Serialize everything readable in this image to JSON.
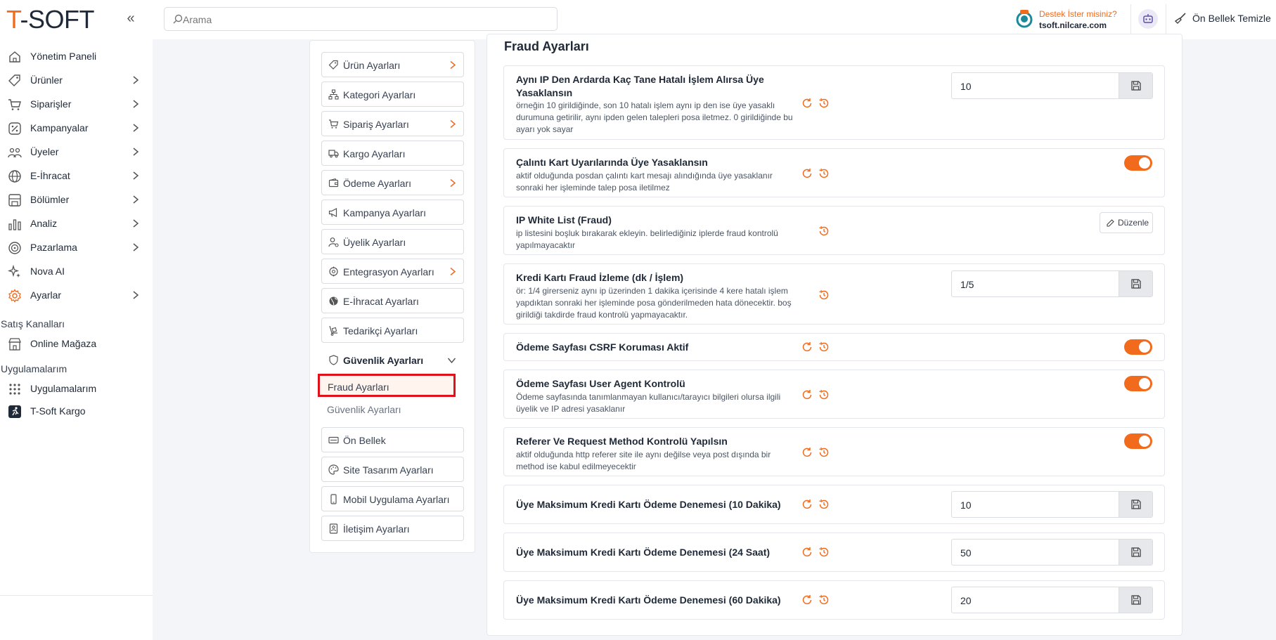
{
  "header": {
    "logo": "T-SOFT",
    "search_placeholder": "Arama",
    "support_question": "Destek İster misiniz?",
    "support_domain": "tsoft.nilcare.com",
    "cache_label": "Ön Bellek Temizle"
  },
  "sidebar": {
    "items": [
      {
        "label": "Yönetim Paneli",
        "icon": "home-icon"
      },
      {
        "label": "Ürünler",
        "icon": "tag-icon"
      },
      {
        "label": "Siparişler",
        "icon": "cart-icon"
      },
      {
        "label": "Kampanyalar",
        "icon": "percent-icon"
      },
      {
        "label": "Üyeler",
        "icon": "users-icon"
      },
      {
        "label": "E-İhracat",
        "icon": "globe-icon"
      },
      {
        "label": "Bölümler",
        "icon": "layout-icon"
      },
      {
        "label": "Analiz",
        "icon": "chart-icon"
      },
      {
        "label": "Pazarlama",
        "icon": "target-icon"
      },
      {
        "label": "Nova AI",
        "icon": "sparkle-icon"
      },
      {
        "label": "Ayarlar",
        "icon": "gear-icon"
      }
    ],
    "sales_channels_title": "Satış Kanalları",
    "online_store": "Online Mağaza",
    "apps_title": "Uygulamalarım",
    "apps_item": "Uygulamalarım",
    "kargo_item": "T-Soft Kargo"
  },
  "settings_menu": {
    "items": [
      {
        "label": "Ürün Ayarları",
        "icon": "tag-icon"
      },
      {
        "label": "Kategori Ayarları",
        "icon": "hierarchy-icon"
      },
      {
        "label": "Sipariş Ayarları",
        "icon": "cart-icon"
      },
      {
        "label": "Kargo Ayarları",
        "icon": "truck-icon"
      },
      {
        "label": "Ödeme Ayarları",
        "icon": "wallet-icon"
      },
      {
        "label": "Kampanya Ayarları",
        "icon": "megaphone-icon"
      },
      {
        "label": "Üyelik Ayarları",
        "icon": "user-gear-icon"
      },
      {
        "label": "Entegrasyon Ayarları",
        "icon": "integration-icon"
      },
      {
        "label": "E-İhracat Ayarları",
        "icon": "globe-icon"
      },
      {
        "label": "Tedarikçi Ayarları",
        "icon": "dolly-icon"
      },
      {
        "label": "Güvenlik Ayarları",
        "icon": "shield-icon"
      },
      {
        "label": "Ön Bellek",
        "icon": "memory-icon"
      },
      {
        "label": "Site Tasarım Ayarları",
        "icon": "palette-icon"
      },
      {
        "label": "Mobil Uygulama Ayarları",
        "icon": "mobile-icon"
      },
      {
        "label": "İletişim Ayarları",
        "icon": "contact-icon"
      }
    ],
    "sub_active": "Fraud Ayarları",
    "sub_other": "Güvenlik Ayarları"
  },
  "main": {
    "title": "Fraud Ayarları",
    "rows": [
      {
        "title": "Aynı IP Den Ardarda Kaç Tane Hatalı İşlem Alırsa Üye Yasaklansın",
        "desc": "örneğin 10 girildiğinde, son 10 hatalı işlem aynı ip den ise üye yasaklı durumuna getirilir, aynı ipden gelen talepleri posa iletmez. 0 girildiğinde bu ayarı yok sayar",
        "control": "input",
        "value": "10"
      },
      {
        "title": "Çalıntı Kart Uyarılarında Üye Yasaklansın",
        "desc": "aktif olduğunda posdan çalıntı kart mesajı alındığında üye yasaklanır sonraki her işleminde talep posa iletilmez",
        "control": "toggle"
      },
      {
        "title": "IP White List (Fraud)",
        "desc": "ip listesini boşluk bırakarak ekleyin. belirlediğiniz iplerde fraud kontrolü yapılmayacaktır",
        "control": "edit",
        "edit_label": "Düzenle"
      },
      {
        "title": "Kredi Kartı Fraud İzleme (dk / İşlem)",
        "desc": "ör: 1/4 girerseniz aynı ip üzerinden 1 dakika içerisinde 4 kere hatalı işlem yapdıktan sonraki her işleminde posa gönderilmeden hata dönecektir. boş girildiği takdirde fraud kontrolü yapmayacaktır.",
        "control": "input",
        "value": "1/5"
      },
      {
        "title": "Ödeme Sayfası CSRF Koruması Aktif",
        "desc": "",
        "control": "toggle"
      },
      {
        "title": "Ödeme Sayfası User Agent Kontrolü",
        "desc": "Ödeme sayfasında tanımlanmayan kullanıcı/tarayıcı bilgileri olursa ilgili üyelik ve IP adresi yasaklanır",
        "control": "toggle"
      },
      {
        "title": "Referer Ve Request Method Kontrolü Yapılsın",
        "desc": "aktif olduğunda http referer site ile aynı değilse veya post dışında bir method ise kabul edilmeyecektir",
        "control": "toggle"
      },
      {
        "title": "Üye Maksimum Kredi Kartı Ödeme Denemesi (10 Dakika)",
        "desc": "",
        "control": "input",
        "value": "10"
      },
      {
        "title": "Üye Maksimum Kredi Kartı Ödeme Denemesi (24 Saat)",
        "desc": "",
        "control": "input",
        "value": "50"
      },
      {
        "title": "Üye Maksimum Kredi Kartı Ödeme Denemesi (60 Dakika)",
        "desc": "",
        "control": "input",
        "value": "20"
      }
    ]
  },
  "colors": {
    "accent": "#f26b1d",
    "highlight": "#e0111b"
  }
}
